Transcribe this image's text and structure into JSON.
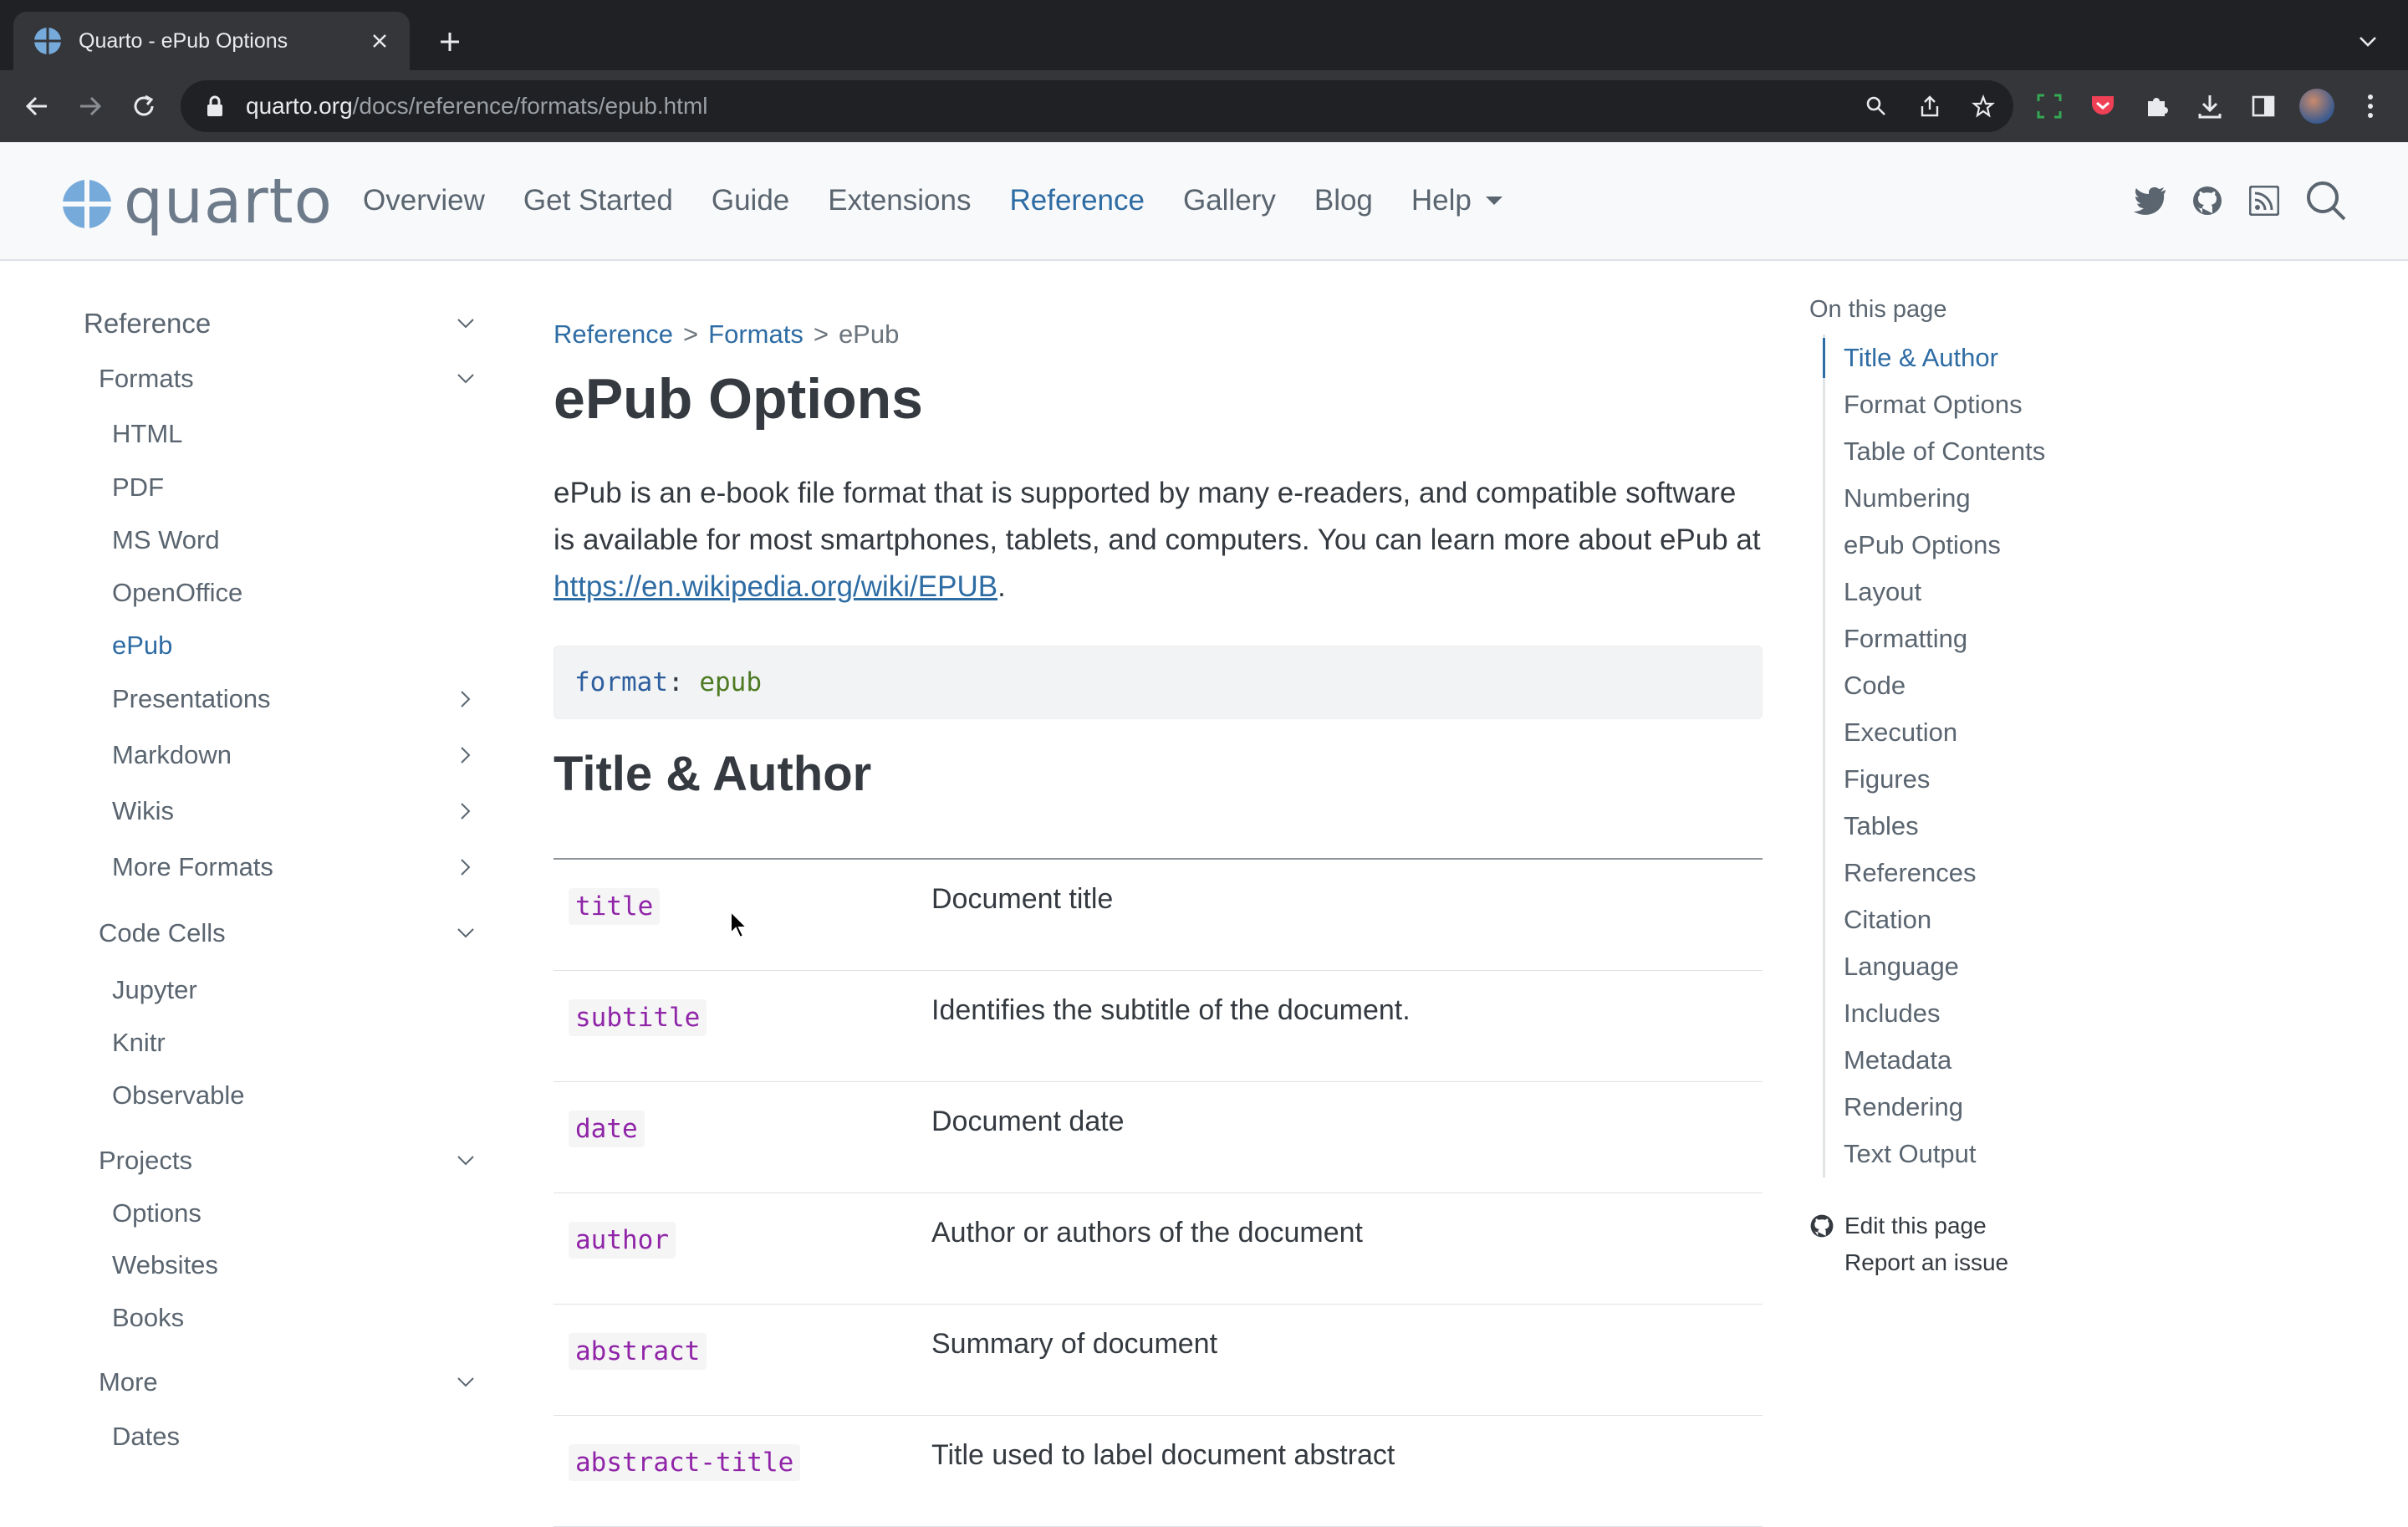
{
  "browser": {
    "tab_title": "Quarto - ePub Options",
    "url_host": "quarto.org",
    "url_path": "/docs/reference/formats/epub.html"
  },
  "site": {
    "logo_text": "quarto",
    "nav": [
      {
        "label": "Overview"
      },
      {
        "label": "Get Started"
      },
      {
        "label": "Guide"
      },
      {
        "label": "Extensions"
      },
      {
        "label": "Reference",
        "active": true
      },
      {
        "label": "Gallery"
      },
      {
        "label": "Blog"
      },
      {
        "label": "Help"
      }
    ],
    "nav_icons": [
      "twitter-icon",
      "github-icon",
      "rss-icon",
      "search-icon"
    ]
  },
  "sidebar": {
    "items": [
      {
        "label": "Reference",
        "level": 0,
        "chevron": "down"
      },
      {
        "label": "Formats",
        "level": 1,
        "chevron": "down"
      },
      {
        "label": "HTML",
        "level": 2
      },
      {
        "label": "PDF",
        "level": 2
      },
      {
        "label": "MS Word",
        "level": 2
      },
      {
        "label": "OpenOffice",
        "level": 2
      },
      {
        "label": "ePub",
        "level": 2,
        "active": true
      },
      {
        "label": "Presentations",
        "level": 2,
        "chevron": "right"
      },
      {
        "label": "Markdown",
        "level": 2,
        "chevron": "right"
      },
      {
        "label": "Wikis",
        "level": 2,
        "chevron": "right"
      },
      {
        "label": "More Formats",
        "level": 2,
        "chevron": "right"
      },
      {
        "label": "Code Cells",
        "level": 1,
        "chevron": "down"
      },
      {
        "label": "Jupyter",
        "level": 2
      },
      {
        "label": "Knitr",
        "level": 2
      },
      {
        "label": "Observable",
        "level": 2
      },
      {
        "label": "Projects",
        "level": 1,
        "chevron": "down"
      },
      {
        "label": "Options",
        "level": 2
      },
      {
        "label": "Websites",
        "level": 2
      },
      {
        "label": "Books",
        "level": 2
      },
      {
        "label": "More",
        "level": 1,
        "chevron": "down"
      },
      {
        "label": "Dates",
        "level": 2
      }
    ]
  },
  "main": {
    "breadcrumb": [
      {
        "label": "Reference",
        "link": true
      },
      {
        "label": "Formats",
        "link": true
      },
      {
        "label": "ePub",
        "link": false
      }
    ],
    "breadcrumb_sep": ">",
    "title": "ePub Options",
    "intro_text": "ePub is an e-book file format that is supported by many e-readers, and compatible software is available for most smartphones, tablets, and computers. You can learn more about ePub at ",
    "intro_link": "https://en.wikipedia.org/wiki/EPUB",
    "intro_end": ".",
    "code": {
      "key": "format",
      "colon": ":",
      "value": "epub"
    },
    "section_title": "Title & Author",
    "options": [
      {
        "name": "title",
        "desc": "Document title"
      },
      {
        "name": "subtitle",
        "desc": "Identifies the subtitle of the document."
      },
      {
        "name": "date",
        "desc": "Document date"
      },
      {
        "name": "author",
        "desc": "Author or authors of the document"
      },
      {
        "name": "abstract",
        "desc": "Summary of document"
      },
      {
        "name": "abstract-title",
        "desc": "Title used to label document abstract"
      }
    ]
  },
  "toc": {
    "heading": "On this page",
    "items": [
      {
        "label": "Title & Author",
        "active": true
      },
      {
        "label": "Format Options"
      },
      {
        "label": "Table of Contents"
      },
      {
        "label": "Numbering"
      },
      {
        "label": "ePub Options"
      },
      {
        "label": "Layout"
      },
      {
        "label": "Formatting"
      },
      {
        "label": "Code"
      },
      {
        "label": "Execution"
      },
      {
        "label": "Figures"
      },
      {
        "label": "Tables"
      },
      {
        "label": "References"
      },
      {
        "label": "Citation"
      },
      {
        "label": "Language"
      },
      {
        "label": "Includes"
      },
      {
        "label": "Metadata"
      },
      {
        "label": "Rendering"
      },
      {
        "label": "Text Output"
      }
    ],
    "edit_link": "Edit this page",
    "issue_link": "Report an issue"
  },
  "colors": {
    "accent": "#2e6ca4",
    "option_name": "#9025a8",
    "chrome_dark": "#202124",
    "chrome_tab": "#35363a"
  }
}
